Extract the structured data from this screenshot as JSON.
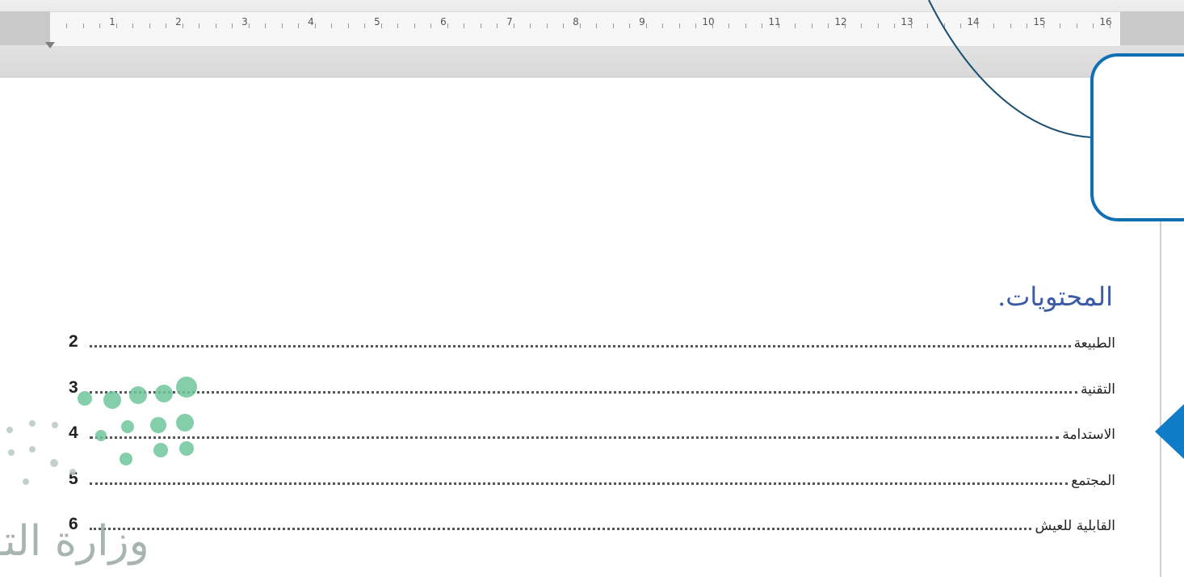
{
  "ruler": {
    "numbers": [
      "1",
      "2",
      "3",
      "4",
      "5",
      "6",
      "7",
      "8",
      "9",
      "10",
      "11",
      "12",
      "13",
      "14",
      "15",
      "16"
    ]
  },
  "toc": {
    "heading": "المحتويات.",
    "entries": [
      {
        "title": "الطبيعة",
        "page": "2"
      },
      {
        "title": "التقنية",
        "page": "3"
      },
      {
        "title": "الاستدامة",
        "page": "4"
      },
      {
        "title": "المجتمع",
        "page": "5"
      },
      {
        "title": "القابلية للعيش",
        "page": "6"
      }
    ]
  },
  "watermark": {
    "text": "وزارة التـ"
  },
  "colors": {
    "accent": "#0e6fb3",
    "heading": "#3a5aa8",
    "watermark_dots": "#6fc59a"
  }
}
